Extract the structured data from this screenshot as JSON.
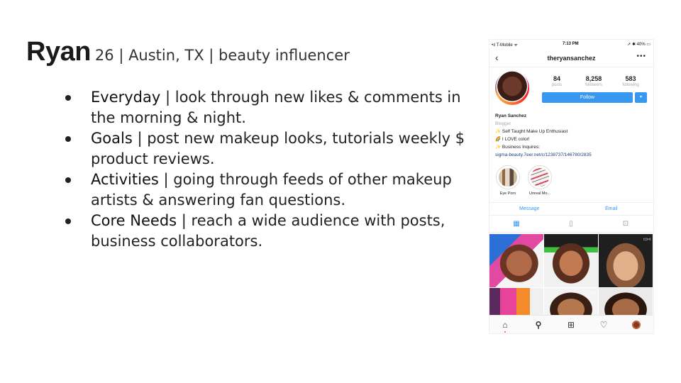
{
  "persona": {
    "name": "Ryan",
    "details": "26 | Austin, TX | beauty influencer"
  },
  "bullets": [
    {
      "term": "Everyday",
      "text": " | look through new likes & comments in the morning & night."
    },
    {
      "term": "Goals",
      "text": " | post new makeup looks, tutorials weekly $ product reviews."
    },
    {
      "term": "Activities",
      "text": " | going through feeds of other makeup artists & answering fan questions."
    },
    {
      "term": "Core Needs",
      "text": " | reach a wide audience with posts, business collaborators."
    }
  ],
  "phone": {
    "status": {
      "carrier": "•ıl T-Mobile ᯤ",
      "time": "7:13 PM",
      "battery": "➚ ✱ 40% ▭"
    },
    "nav": {
      "back_icon": "‹",
      "username": "theryansanchez",
      "more_icon": "•••"
    },
    "stats": [
      {
        "value": "84",
        "label": "posts"
      },
      {
        "value": "8,258",
        "label": "followers"
      },
      {
        "value": "583",
        "label": "following"
      }
    ],
    "follow_label": "Follow",
    "follow_dropdown_icon": "▾",
    "bio": {
      "name": "Ryan Sanchez",
      "category": "Blogger",
      "line1": "✨ Self Taught Make Up Enthusiast",
      "line2": "🌈 I LOVE color!",
      "line3": "✨ Business Inquires:",
      "link": "sigma-beauty.7eer.net/c/1238737/146780/2835"
    },
    "highlights": [
      {
        "label": "Eye Porn"
      },
      {
        "label": "Unreal Mo..."
      }
    ],
    "actions": {
      "message": "Message",
      "email": "Email"
    },
    "tabs": {
      "grid_icon": "▦",
      "feed_icon": "▯",
      "tagged_icon": "⊡"
    },
    "video_icon": "▭◃",
    "bottom_icons": {
      "home": "⌂",
      "search": "⚲",
      "add": "⊞",
      "heart": "♡"
    }
  },
  "colors": {
    "accent": "#3897f0",
    "text": "#222222",
    "link": "#1b3f74"
  }
}
